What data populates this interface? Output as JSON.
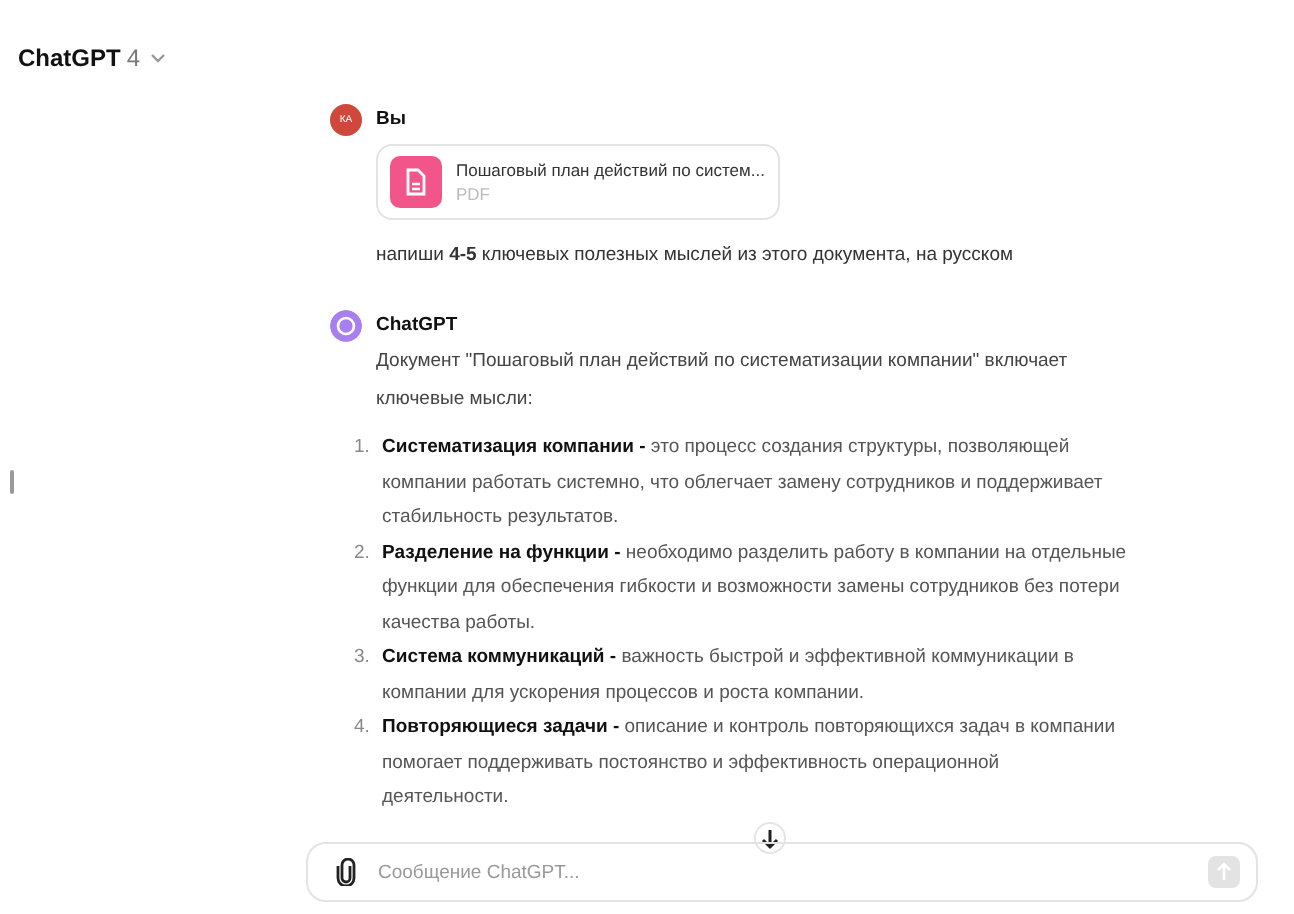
{
  "header": {
    "title": "ChatGPT",
    "version": "4"
  },
  "messages": [
    {
      "kind": "user",
      "avatar": "КА",
      "author": "Вы",
      "attachment": {
        "name": "Пошаговый план действий по систем...",
        "type": "PDF"
      },
      "text": "напиши **4-5** ключевых полезных мыслей из этого документа, на русском"
    },
    {
      "kind": "assistant",
      "author": "ChatGPT",
      "text": "Документ \"Пошаговый план действий по систематизации компании\" включает ключевые мысли:",
      "list": [
        {
          "num": "1.",
          "title": "Систематизация компании -",
          "text": "это процесс создания структуры, позволяющей компании работать системно, что облегчает замену сотрудников и поддерживает стабильность результатов."
        },
        {
          "num": "2.",
          "title": "Разделение на функции -",
          "text": "необходимо разделить работу в компании на отдельные функции для обеспечения гибкости и возможности замены сотрудников без потери качества работы."
        },
        {
          "num": "3.",
          "title": "Система коммуникаций -",
          "text": "важность быстрой и эффективной коммуникации в компании для ускорения процессов и роста компании."
        },
        {
          "num": "4.",
          "title": "Повторяющиеся задачи -",
          "text": "описание и контроль повторяющихся задач в компании помогает поддерживать постоянство и эффективность операционной деятельности."
        }
      ]
    }
  ],
  "composer": {
    "placeholder": "Сообщение ChatGPT...",
    "send_disabled": true
  }
}
